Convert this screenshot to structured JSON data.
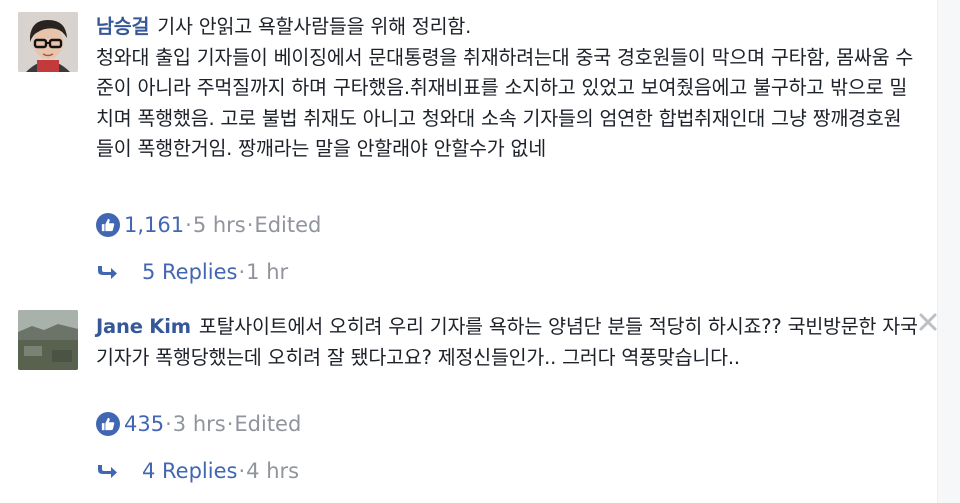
{
  "comments": [
    {
      "author": "남승걸",
      "text": "기사 안읽고 욕할사람들을 위해 정리함.\n청와대 출입 기자들이 베이징에서 문대통령을 취재하려는대 중국 경호원들이 막으며 구타함, 몸싸움 수준이 아니라 주먹질까지 하며 구타했음.취재비표를 소지하고 있었고 보여줬음에고 불구하고 밖으로 밀치며 폭행했음. 고로 불법 취재도 아니고 청와대 소속 기자들의 엄연한 합법취재인대 그냥 짱깨경호원들이 폭행한거임. 짱깨라는 말을 안할래야 안할수가 없네",
      "like_count": "1,161",
      "time": "5 hrs",
      "edited": "Edited",
      "replies_label": "5 Replies",
      "replies_time": "1 hr",
      "avatar_icon": "user-avatar-glasses"
    },
    {
      "author": "Jane Kim",
      "text": "포탈사이트에서 오히려 우리 기자를 욕하는 양념단 분들 적당히 하시죠?? 국빈방문한 자국기자가 폭행당했는데 오히려 잘 됐다고요? 제정신들인가.. 그러다 역풍맞습니다..",
      "like_count": "435",
      "time": "3 hrs",
      "edited": "Edited",
      "replies_label": "4 Replies",
      "replies_time": "4 hrs",
      "avatar_icon": "user-avatar-landscape"
    }
  ],
  "separator": " · ",
  "colors": {
    "link": "#365899",
    "accent": "#4267b2",
    "meta": "#90949c",
    "text": "#1d2129"
  }
}
